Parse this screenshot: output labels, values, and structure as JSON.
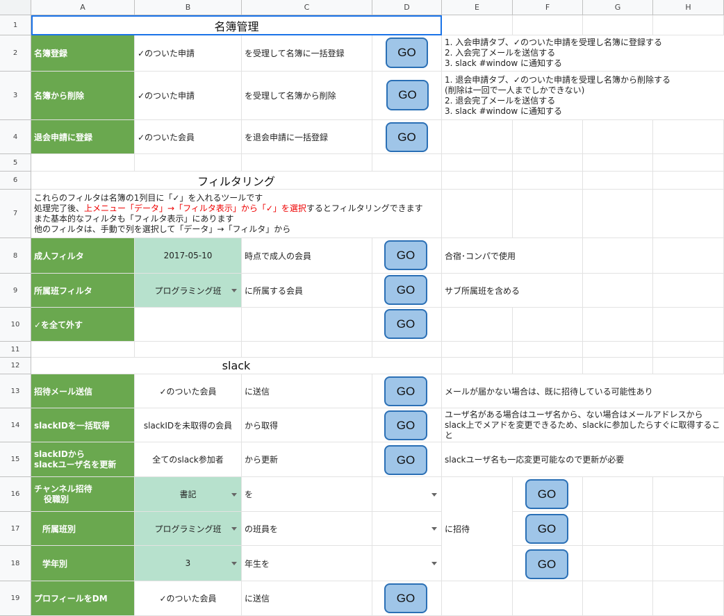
{
  "columns": [
    "A",
    "B",
    "C",
    "D",
    "E",
    "F",
    "G",
    "H"
  ],
  "rows": [
    "1",
    "2",
    "3",
    "4",
    "5",
    "6",
    "7",
    "8",
    "9",
    "10",
    "11",
    "12",
    "13",
    "14",
    "15",
    "16",
    "17",
    "18",
    "19"
  ],
  "go_label": "GO",
  "colors": {
    "green": "#6aa84f",
    "mint": "#b7e1cd",
    "button": "#9fc5e8",
    "button_border": "#2a6fb5",
    "red_text": "#ee0000"
  },
  "section1": {
    "title": "名簿管理"
  },
  "r2": {
    "a": "名簿登録",
    "b": "✓のついた申請",
    "c": "を受理して名簿に一括登録",
    "e": [
      "1. 入会申請タブ、✓のついた申請を受理し名簿に登録する",
      "2. 入会完了メールを送信する",
      "3. slack #window に通知する"
    ]
  },
  "r3": {
    "a": "名簿から削除",
    "b": "✓のついた申請",
    "c": "を受理して名簿から削除",
    "e": [
      "1. 退会申請タブ、✓のついた申請を受理し名簿から削除する",
      "(削除は一回で一人までしかできない)",
      "2. 退会完了メールを送信する",
      "3. slack #window に通知する"
    ]
  },
  "r4": {
    "a": "退会申請に登録",
    "b": "✓のついた会員",
    "c": "を退会申請に一括登録"
  },
  "section2": {
    "title": "フィルタリング"
  },
  "r7": {
    "l1": "これらのフィルタは名簿の1列目に「✓」を入れるツールです",
    "l2a": "処理完了後、",
    "l2b": "上メニュー「データ」→「フィルタ表示」から「✓」を選択",
    "l2c": "するとフィルタリングできます",
    "l3": "また基本的なフィルタも「フィルタ表示」にあります",
    "l4": "他のフィルタは、手動で列を選択して「データ」→「フィルタ」から"
  },
  "r8": {
    "a": "成人フィルタ",
    "b": "2017-05-10",
    "c": "時点で成人の会員",
    "e": "合宿･コンパで使用"
  },
  "r9": {
    "a": "所属班フィルタ",
    "b": "プログラミング班",
    "c": "に所属する会員",
    "e": "サブ所属班を含める"
  },
  "r10": {
    "a": "✓を全て外す"
  },
  "section3": {
    "title": "slack"
  },
  "r13": {
    "a": "招待メール送信",
    "b": "✓のついた会員",
    "c": "に送信",
    "e": "メールが届かない場合は、既に招待している可能性あり"
  },
  "r14": {
    "a": "slackIDを一括取得",
    "b": "slackIDを未取得の会員",
    "c": "から取得",
    "e": [
      "ユーザ名がある場合はユーザ名から、ない場合はメールアドレスから",
      "slack上でメアドを変更できるため、slackに参加したらすぐに取得すること"
    ]
  },
  "r15": {
    "a1": "slackIDから",
    "a2": "slackユーザ名を更新",
    "b": "全てのslack参加者",
    "c": "から更新",
    "e": "slackユーザ名も一応変更可能なので更新が必要"
  },
  "r16": {
    "a1": "チャンネル招待",
    "a2": "役職別",
    "b": "書記",
    "c": "を"
  },
  "r17": {
    "a": "所属班別",
    "b": "プログラミング班",
    "c": "の班員を",
    "e": "に招待"
  },
  "r18": {
    "a": "学年別",
    "b": "3",
    "c": "年生を"
  },
  "r19": {
    "a": "プロフィールをDM",
    "b": "✓のついた会員",
    "c": "に送信"
  }
}
